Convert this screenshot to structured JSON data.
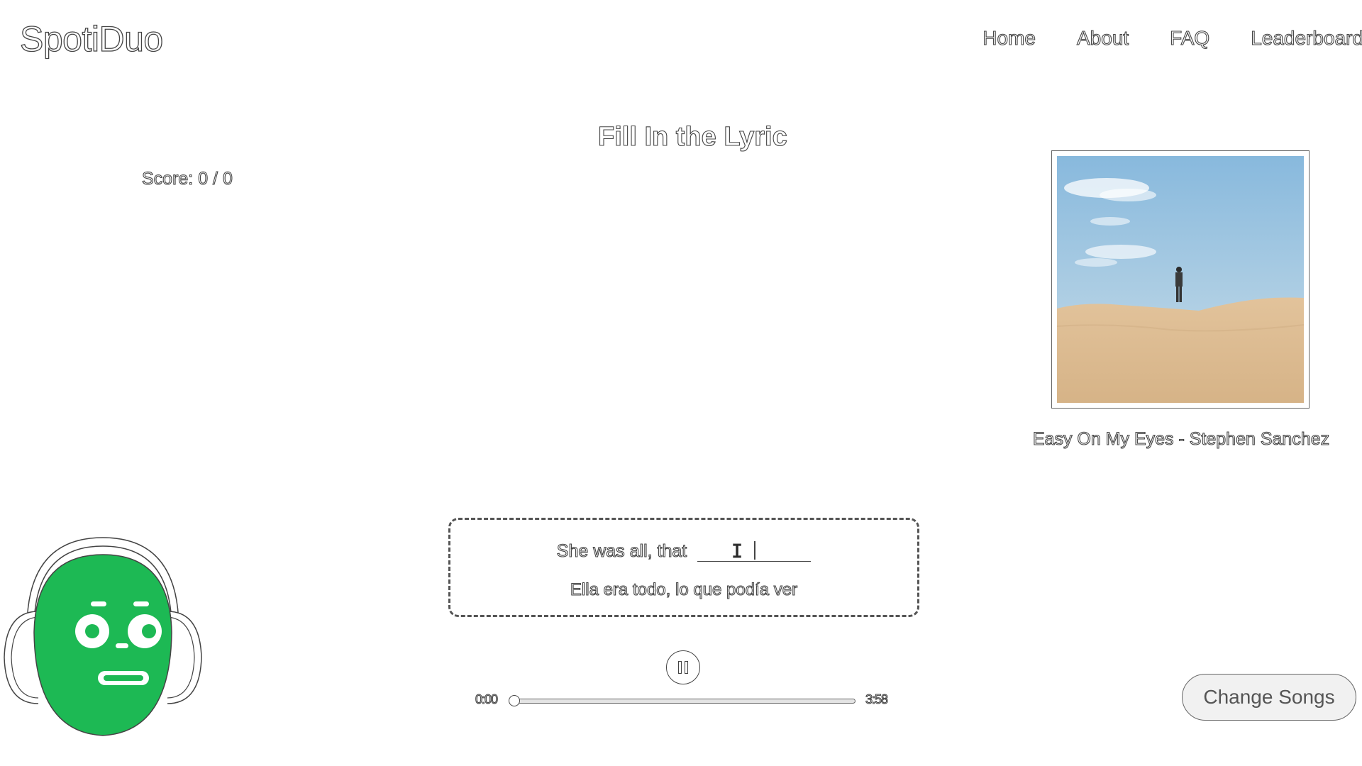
{
  "app": {
    "logo": "SpotiDuo"
  },
  "nav": {
    "items": [
      {
        "label": "Home"
      },
      {
        "label": "About"
      },
      {
        "label": "FAQ"
      },
      {
        "label": "Leaderboard"
      }
    ]
  },
  "game": {
    "title": "Fill In the Lyric",
    "score": "Score: 0 / 0"
  },
  "song": {
    "label": "Easy On My Eyes - Stephen Sanchez"
  },
  "lyric": {
    "prompt": "She was all, that",
    "answer_value": "",
    "translation": "Ella era todo, lo que podía ver"
  },
  "player": {
    "current_time": "0:00",
    "total_time": "3:58",
    "progress": 0,
    "state": "playing"
  },
  "actions": {
    "change_songs": "Change Songs"
  },
  "colors": {
    "mascot_green": "#1db954",
    "text_outline": "#444444",
    "button_bg": "#f1f1f1"
  },
  "icons": {
    "pause": "pause-icon",
    "mascot": "mascot-headphones-icon",
    "cursor": "text-cursor-icon"
  }
}
